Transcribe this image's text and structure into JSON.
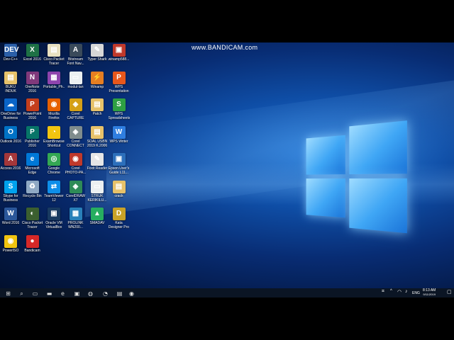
{
  "watermark": "www.BANDICAM.com",
  "colors": {
    "wallpaper": "#0f4fa8",
    "taskbar": "#0b1524",
    "logo": "#3fa6f5"
  },
  "desktop_icons": [
    {
      "label": "Dev-C++",
      "glyph": "DEV",
      "color": "#2b5fa8",
      "icon": "devcpp-icon"
    },
    {
      "label": "Excel 2016",
      "glyph": "X",
      "color": "#1e7145",
      "icon": "excel-icon"
    },
    {
      "label": "Cisco Packet Tracer 6.0.1...",
      "glyph": "▤",
      "color": "#e8e0c0",
      "icon": "file-icon"
    },
    {
      "label": "Bitstream Font Nav...",
      "glyph": "A",
      "color": "#3a4a5a",
      "icon": "font-navigator-icon"
    },
    {
      "label": "Typer Shark",
      "glyph": "✎",
      "color": "#d7d7d7",
      "icon": "typer-shark-icon"
    },
    {
      "label": "winamp588...",
      "glyph": "▣",
      "color": "#c0392b",
      "icon": "winamp-installer-icon"
    },
    {
      "label": "BUKU INDUK",
      "glyph": "▤",
      "color": "#e7c26a",
      "icon": "folder-icon"
    },
    {
      "label": "OneNote 2016",
      "glyph": "N",
      "color": "#80397b",
      "icon": "onenote-icon"
    },
    {
      "label": "Portable_Ph...",
      "glyph": "▦",
      "color": "#8e44ad",
      "icon": "archive-icon"
    },
    {
      "label": "modul-lan",
      "glyph": "▭",
      "color": "#ecf0f1",
      "icon": "document-icon"
    },
    {
      "label": "Winamp",
      "glyph": "⚡",
      "color": "#e67e22",
      "icon": "winamp-icon"
    },
    {
      "label": "WPS Presentation",
      "glyph": "P",
      "color": "#e8571c",
      "icon": "wps-presentation-icon"
    },
    {
      "label": "OneDrive for Business",
      "glyph": "☁",
      "color": "#0a64c8",
      "icon": "onedrive-icon"
    },
    {
      "label": "PowerPoint 2016",
      "glyph": "P",
      "color": "#c43e1c",
      "icon": "powerpoint-icon"
    },
    {
      "label": "Mozilla Firefox",
      "glyph": "◉",
      "color": "#e66000",
      "icon": "firefox-icon"
    },
    {
      "label": "Corel CAPTURE X7",
      "glyph": "◈",
      "color": "#d4a017",
      "icon": "corel-capture-icon"
    },
    {
      "label": "Patch",
      "glyph": "▤",
      "color": "#e7c26a",
      "icon": "folder-icon"
    },
    {
      "label": "WPS Spreadsheets",
      "glyph": "S",
      "color": "#2ea043",
      "icon": "wps-spreadsheets-icon"
    },
    {
      "label": "Outlook 2016",
      "glyph": "O",
      "color": "#0072c6",
      "icon": "outlook-icon"
    },
    {
      "label": "Publisher 2016",
      "glyph": "P",
      "color": "#077568",
      "icon": "publisher-icon"
    },
    {
      "label": "ExamBrowser Shortcut",
      "glyph": "◔",
      "color": "#f1c40f",
      "icon": "exambrowser-icon"
    },
    {
      "label": "Corel CONNECT X7",
      "glyph": "◈",
      "color": "#7f8c8d",
      "icon": "corel-connect-icon"
    },
    {
      "label": "SOAL USBN 2019 K.2006",
      "glyph": "▤",
      "color": "#e7c26a",
      "icon": "folder-icon"
    },
    {
      "label": "WPS Writer",
      "glyph": "W",
      "color": "#2f7ee0",
      "icon": "wps-writer-icon"
    },
    {
      "label": "Access 2016",
      "glyph": "A",
      "color": "#a4373a",
      "icon": "access-icon"
    },
    {
      "label": "Microsoft Edge",
      "glyph": "e",
      "color": "#0078d7",
      "icon": "edge-icon"
    },
    {
      "label": "Google Chrome",
      "glyph": "◎",
      "color": "#34a853",
      "icon": "chrome-icon"
    },
    {
      "label": "Corel PHOTO-PA...",
      "glyph": "◉",
      "color": "#c0392b",
      "icon": "corel-photopaint-icon"
    },
    {
      "label": "Foxit Reader",
      "glyph": "✎",
      "color": "#e6e6e6",
      "icon": "foxit-reader-icon"
    },
    {
      "label": "Epson User's Guide L11...",
      "glyph": "▣",
      "color": "#2c6fbb",
      "icon": "epson-guide-icon"
    },
    {
      "label": "Skype for Business 2016",
      "glyph": "S",
      "color": "#00a2ed",
      "icon": "skype-icon"
    },
    {
      "label": "Recycle Bin",
      "glyph": "♻",
      "color": "#8fa9c4",
      "icon": "recycle-bin-icon"
    },
    {
      "label": "TeamViewer 12",
      "glyph": "⇄",
      "color": "#0e8ee9",
      "icon": "teamviewer-icon"
    },
    {
      "label": "CorelDRAW X7",
      "glyph": "◈",
      "color": "#2e8b57",
      "icon": "coreldraw-icon"
    },
    {
      "label": "STRUK KERIKILU...",
      "glyph": "▭",
      "color": "#ecf0f1",
      "icon": "document-icon"
    },
    {
      "label": "crack",
      "glyph": "▤",
      "color": "#e7c26a",
      "icon": "folder-icon"
    },
    {
      "label": "Word 2016",
      "glyph": "W",
      "color": "#2b579a",
      "icon": "word-icon"
    },
    {
      "label": "Cisco Packet Tracer",
      "glyph": "◐",
      "color": "#3b5f2f",
      "icon": "cisco-packet-tracer-icon"
    },
    {
      "label": "Oracle VM VirtualBox",
      "glyph": "▣",
      "color": "#183a61",
      "icon": "virtualbox-icon"
    },
    {
      "label": "PROLINK WN200...",
      "glyph": "▦",
      "color": "#2980b9",
      "icon": "prolink-icon"
    },
    {
      "label": "SMADAV",
      "glyph": "▲",
      "color": "#27ae60",
      "icon": "smadav-icon"
    },
    {
      "label": "Kata Designer Pro X9 (32-...",
      "glyph": "D",
      "color": "#c9a227",
      "icon": "designer-pro-icon"
    },
    {
      "label": "PowerISO",
      "glyph": "◉",
      "color": "#f1c40f",
      "icon": "poweriso-icon"
    },
    {
      "label": "Bandicam",
      "glyph": "●",
      "color": "#d62828",
      "icon": "bandicam-icon"
    }
  ],
  "taskbar": {
    "items": [
      {
        "name": "start-icon",
        "glyph": "⊞"
      },
      {
        "name": "search-icon",
        "glyph": "⌕"
      },
      {
        "name": "task-view-icon",
        "glyph": "▭"
      },
      {
        "name": "file-explorer-icon",
        "glyph": "▬"
      },
      {
        "name": "edge-taskbar-icon",
        "glyph": "e"
      },
      {
        "name": "store-icon",
        "glyph": "▣"
      },
      {
        "name": "dx-app-icon",
        "glyph": "◍"
      },
      {
        "name": "exambrowser-taskbar-icon",
        "glyph": "◔"
      },
      {
        "name": "notepad-taskbar-icon",
        "glyph": "▤"
      },
      {
        "name": "bandicam-taskbar-icon",
        "glyph": "◉"
      }
    ],
    "tray": {
      "language": "ENG",
      "time": "8:13 AM",
      "date": "9/11/2019"
    }
  }
}
